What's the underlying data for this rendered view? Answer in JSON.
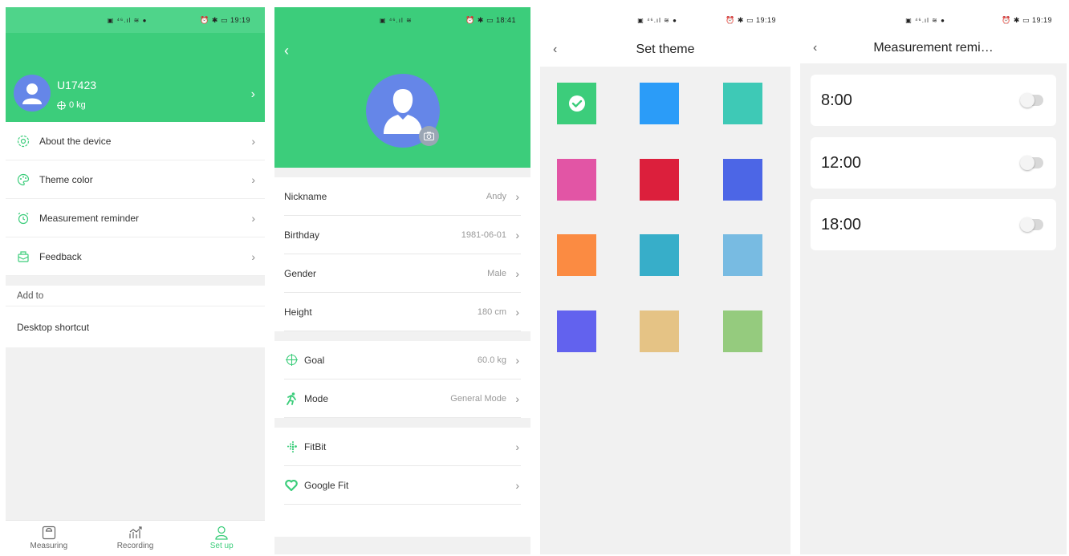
{
  "status": {
    "s1": {
      "icons": "▣ ⁴⁶.ıl ≋ ●",
      "right": "⏰ ✱ ▭ 19:19"
    },
    "s2": {
      "icons": "▣ ⁴⁶.ıl ≋",
      "right": "⏰ ✱ ▭ 18:41"
    },
    "s3": {
      "icons": "▣ ⁴⁶.ıl ≋ ●",
      "right": "⏰ ✱ ▭ 19:19"
    },
    "s4": {
      "icons": "▣ ⁴⁶.ıl ≋ ●",
      "right": "⏰ ✱ ▭ 19:19"
    }
  },
  "profile": {
    "username": "U17423",
    "weight": "0 kg"
  },
  "menu": [
    {
      "label": "About the device",
      "icon": "gear-icon"
    },
    {
      "label": "Theme color",
      "icon": "palette-icon"
    },
    {
      "label": "Measurement reminder",
      "icon": "alarm-icon"
    },
    {
      "label": "Feedback",
      "icon": "feedback-icon"
    }
  ],
  "add_to": {
    "header": "Add to",
    "item": "Desktop shortcut"
  },
  "tabs": [
    {
      "label": "Measuring",
      "icon": "scale-icon"
    },
    {
      "label": "Recording",
      "icon": "chart-icon"
    },
    {
      "label": "Set up",
      "icon": "person-icon",
      "active": true
    }
  ],
  "personal": [
    {
      "label": "Nickname",
      "value": "Andy"
    },
    {
      "label": "Birthday",
      "value": "1981-06-01"
    },
    {
      "label": "Gender",
      "value": "Male"
    },
    {
      "label": "Height",
      "value": "180 cm"
    }
  ],
  "goal_mode": [
    {
      "label": "Goal",
      "value": "60.0 kg",
      "icon": "target-icon"
    },
    {
      "label": "Mode",
      "value": "General Mode",
      "icon": "runner-icon"
    }
  ],
  "integrations": [
    {
      "label": "FitBit",
      "icon": "fitbit-icon"
    },
    {
      "label": "Google Fit",
      "icon": "googlefit-icon"
    }
  ],
  "theme": {
    "title": "Set theme",
    "colors": [
      "#3ccd7b",
      "#2b9cf8",
      "#3ec9b6",
      "#e255a5",
      "#dc1f3c",
      "#4c66e6",
      "#fb8b42",
      "#37aec9",
      "#78bbe2",
      "#6262ee",
      "#e5c385",
      "#95cb7e"
    ],
    "selected_index": 0
  },
  "reminder": {
    "title": "Measurement remi…",
    "times": [
      "8:00",
      "12:00",
      "18:00"
    ]
  },
  "colors": {
    "accent": "#3ccd7b",
    "avatar": "#6586e8"
  }
}
